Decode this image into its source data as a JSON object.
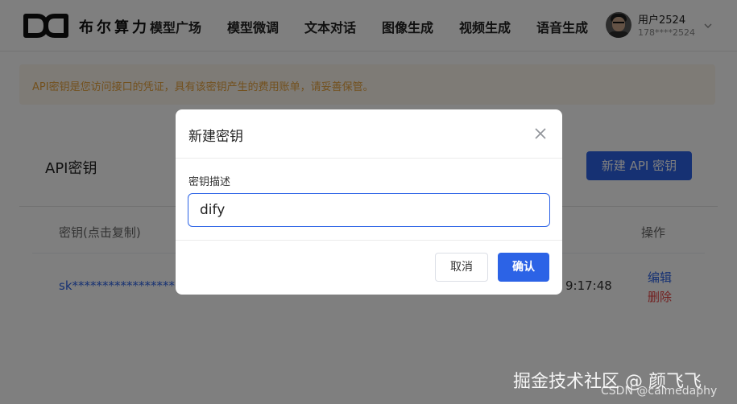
{
  "header": {
    "brand": "布尔算力",
    "nav": [
      {
        "label": "模型广场"
      },
      {
        "label": "模型微调"
      },
      {
        "label": "文本对话"
      },
      {
        "label": "图像生成"
      },
      {
        "label": "视频生成"
      },
      {
        "label": "语音生成"
      }
    ],
    "user": {
      "name": "用户2524",
      "phone": "178****2524"
    }
  },
  "page": {
    "notice": "API密钥是您访问接口的凭证，具有该密钥产生的费用账单，请妥善保管。",
    "title": "API密钥",
    "new_button": "新建 API 密钥",
    "table": {
      "columns": {
        "key": "密钥(点击复制)",
        "actions": "操作"
      },
      "row": {
        "key": "sk*****************",
        "time": "9:17:48",
        "edit": "编辑",
        "delete": "删除"
      }
    }
  },
  "dialog": {
    "title": "新建密钥",
    "field_label": "密钥描述",
    "field_value": "dify",
    "cancel": "取消",
    "confirm": "确认"
  },
  "watermark": {
    "line1": "掘金技术社区 @ 颜飞飞",
    "line2": "CSDN @calmedaphy"
  },
  "colors": {
    "primary": "#2c63e6",
    "danger": "#e64242",
    "notice_text": "#e6a23c",
    "notice_bg": "#fdf6ec"
  },
  "icons": [
    "logo-mark",
    "avatar",
    "chevron-down-icon",
    "close-icon"
  ]
}
